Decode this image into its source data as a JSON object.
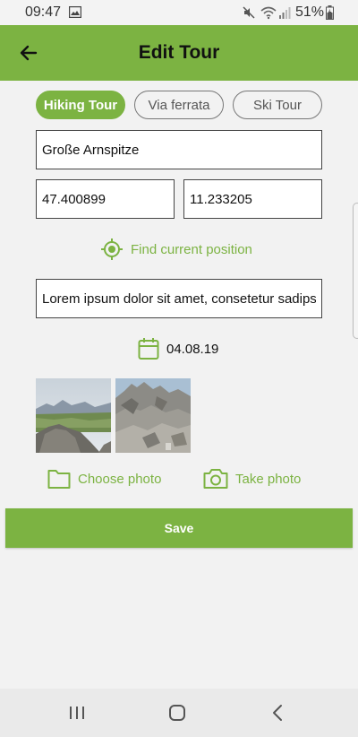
{
  "status_bar": {
    "time": "09:47",
    "battery": "51%"
  },
  "app_bar": {
    "title": "Edit Tour",
    "back_icon": "arrow-back-icon"
  },
  "tour_types": [
    {
      "label": "Hiking Tour",
      "selected": true
    },
    {
      "label": "Via ferrata",
      "selected": false
    },
    {
      "label": "Ski Tour",
      "selected": false
    }
  ],
  "form": {
    "name": "Große Arnspitze",
    "latitude": "47.400899",
    "longitude": "11.233205",
    "find_position_label": "Find current position",
    "description": "Lorem ipsum dolor sit amet, consetetur sadipscing",
    "date": "04.08.19"
  },
  "photos": {
    "choose_label": "Choose photo",
    "take_label": "Take photo"
  },
  "save_label": "Save",
  "colors": {
    "accent": "#7cb342",
    "background": "#f2f2f2"
  }
}
